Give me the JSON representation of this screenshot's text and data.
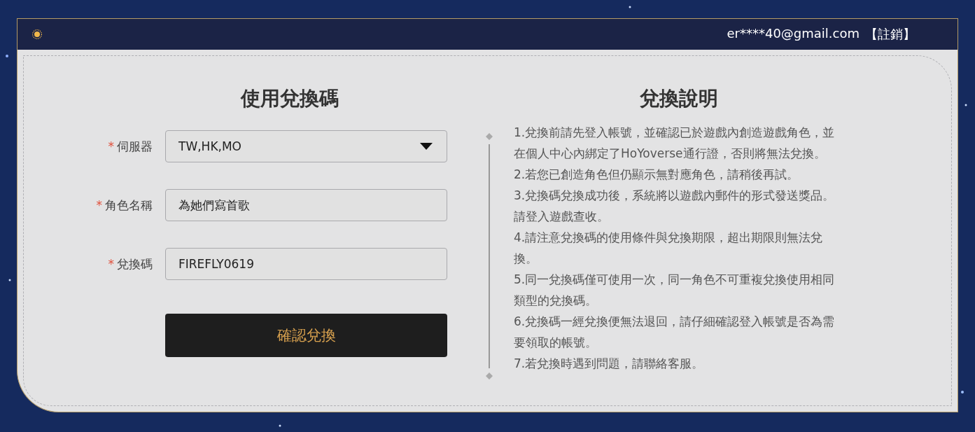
{
  "header": {
    "account": "er****40@gmail.com",
    "logout": "【註銷】"
  },
  "redeem": {
    "title": "使用兌換碼",
    "fields": [
      {
        "kind": "select",
        "required_mark": "*",
        "label": "伺服器",
        "value": "TW,HK,MO"
      },
      {
        "kind": "text",
        "required_mark": "*",
        "label": "角色名稱",
        "value": "為她們寫首歌"
      },
      {
        "kind": "text",
        "required_mark": "*",
        "label": "兌換碼",
        "value": "FIREFLY0619"
      }
    ],
    "submit": "確認兌換"
  },
  "instructions": {
    "title": "兌換說明",
    "items": [
      "1.兌換前請先登入帳號，並確認已於遊戲內創造遊戲角色，並在個人中心內綁定了HoYoverse通行證，否則將無法兌換。",
      "2.若您已創造角色但仍顯示無對應角色，請稍後再試。",
      "3.兌換碼兌換成功後，系統將以遊戲內郵件的形式發送獎品。請登入遊戲查收。",
      "4.請注意兌換碼的使用條件與兌換期限，超出期限則無法兌換。",
      "5.同一兌換碼僅可使用一次，同一角色不可重複兌換使用相同類型的兌換碼。",
      "6.兌換碼一經兌換便無法退回，請仔細確認登入帳號是否為需要領取的帳號。",
      "7.若兌換時遇到問題，請聯絡客服。"
    ]
  }
}
